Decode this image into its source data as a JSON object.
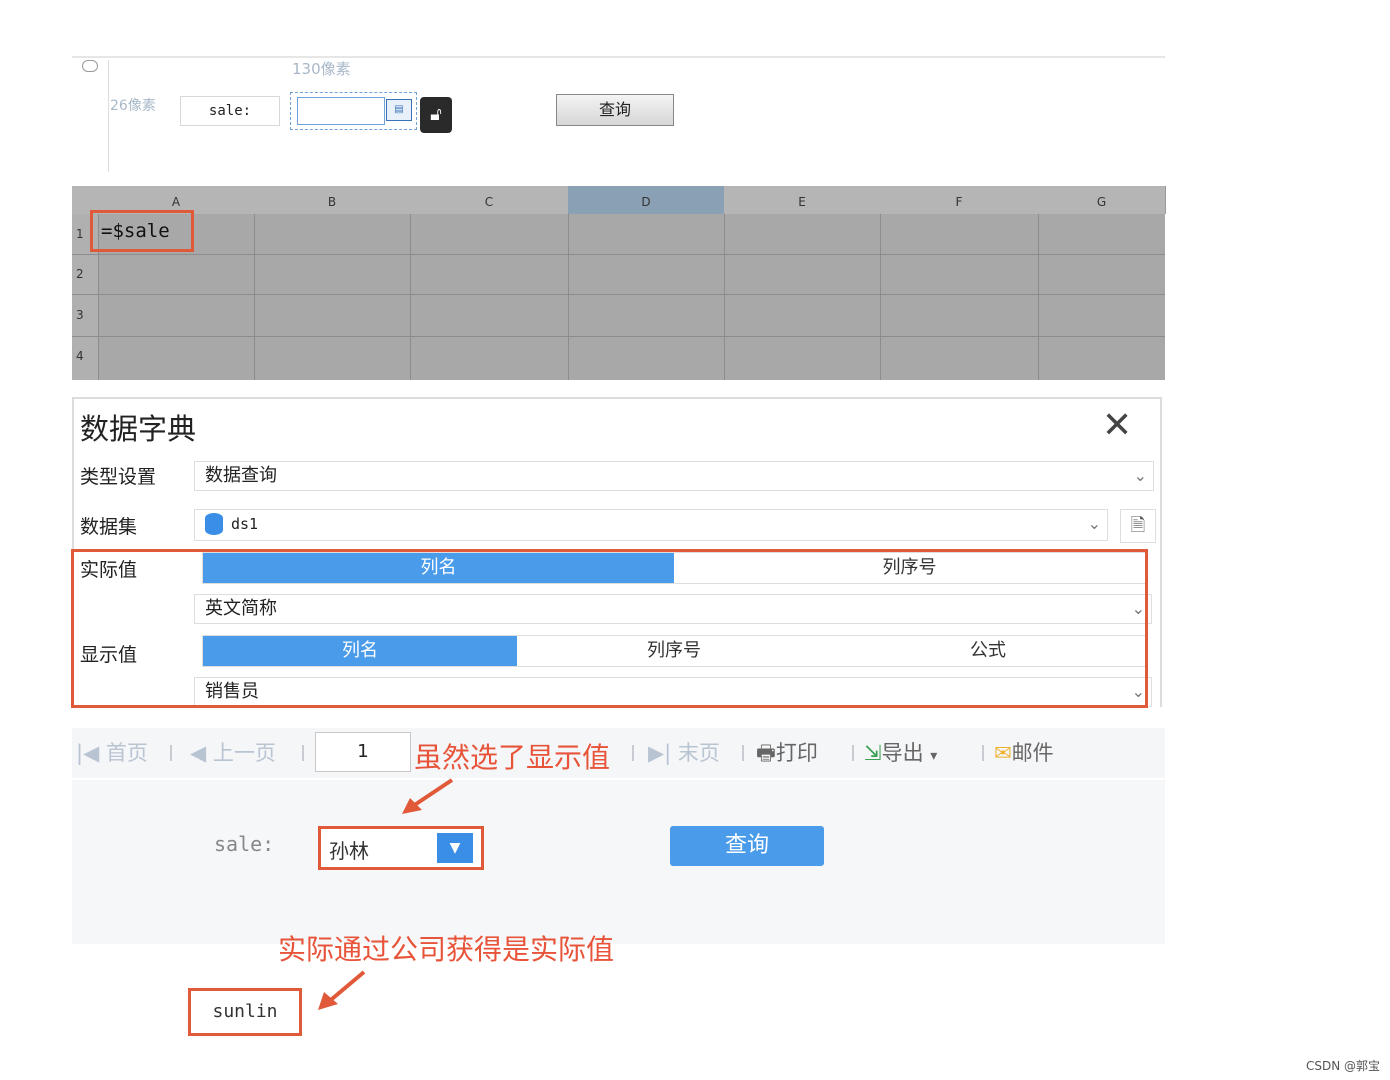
{
  "designer": {
    "ruler_top_label": "130像素",
    "ruler_left_label": "26像素",
    "param_label": "sale:",
    "query_button": "查询"
  },
  "sheet": {
    "columns": [
      "A",
      "B",
      "C",
      "D",
      "E",
      "F",
      "G"
    ],
    "selected_column": "D",
    "rows": [
      "1",
      "2",
      "3",
      "4"
    ],
    "cell_a1": "=$sale"
  },
  "dictionary": {
    "title": "数据字典",
    "type_label": "类型设置",
    "type_value": "数据查询",
    "dataset_label": "数据集",
    "dataset_value": "ds1",
    "actual_label": "实际值",
    "actual_tabs": [
      "列名",
      "列序号"
    ],
    "actual_selected": "列名",
    "actual_value": "英文简称",
    "display_label": "显示值",
    "display_tabs": [
      "列名",
      "列序号",
      "公式"
    ],
    "display_selected": "列名",
    "display_value": "销售员"
  },
  "toolbar": {
    "first": "首页",
    "prev": "上一页",
    "page": "1",
    "last": "末页",
    "print": "打印",
    "export": "导出",
    "mail": "邮件"
  },
  "annotations": {
    "display_note": "虽然选了显示值",
    "actual_note": "实际通过公司获得是实际值"
  },
  "preview": {
    "param_label": "sale:",
    "combo_value": "孙林",
    "query_button": "查询",
    "result": "sunlin"
  },
  "watermark": "CSDN @郭宝",
  "colors": {
    "accent_blue": "#4a9bea",
    "annotation_red": "#e05a3a"
  }
}
